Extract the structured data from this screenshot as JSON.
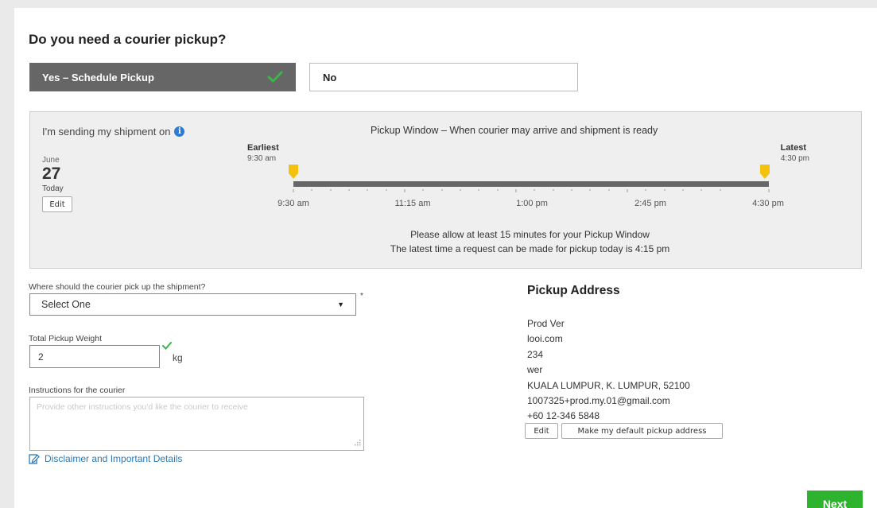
{
  "question": "Do you need a courier pickup?",
  "options": {
    "yes_label": "Yes – Schedule Pickup",
    "no_label": "No"
  },
  "schedule": {
    "sending_label": "I'm sending my shipment on",
    "month": "June",
    "day": "27",
    "today": "Today",
    "edit_label": "Edit",
    "window_title": "Pickup Window – When courier may arrive and shipment is ready",
    "earliest_label": "Earliest",
    "earliest_time": "9:30 am",
    "latest_label": "Latest",
    "latest_time": "4:30 pm",
    "ticks": [
      "9:30 am",
      "11:15 am",
      "1:00 pm",
      "2:45 pm",
      "4:30 pm"
    ],
    "note1": "Please allow at least 15 minutes for your Pickup Window",
    "note2": "The latest time a request can be made for pickup today is 4:15 pm"
  },
  "form": {
    "where_label": "Where should the courier pick up the shipment?",
    "select_value": "Select One",
    "required_mark": "*",
    "weight_label": "Total Pickup Weight",
    "weight_value": "2",
    "weight_unit": "kg",
    "instructions_label": "Instructions for the courier",
    "instructions_placeholder": "Provide other instructions you'd like the courier to receive",
    "disclaimer": "Disclaimer and Important Details"
  },
  "address": {
    "title": "Pickup Address",
    "lines": [
      "Prod Ver",
      "looi.com",
      "234",
      "wer",
      "KUALA LUMPUR, K. LUMPUR, 52100",
      "1007325+prod.my.01@gmail.com",
      "+60 12-346 5848"
    ],
    "edit_label": "Edit",
    "default_label": "Make my default pickup address"
  },
  "next_label": "Next",
  "colors": {
    "selected_option": "#666666",
    "check": "#3bb54a",
    "next_button": "#2eb32e",
    "link": "#2a7ab8",
    "marker": "#f4c20d"
  }
}
